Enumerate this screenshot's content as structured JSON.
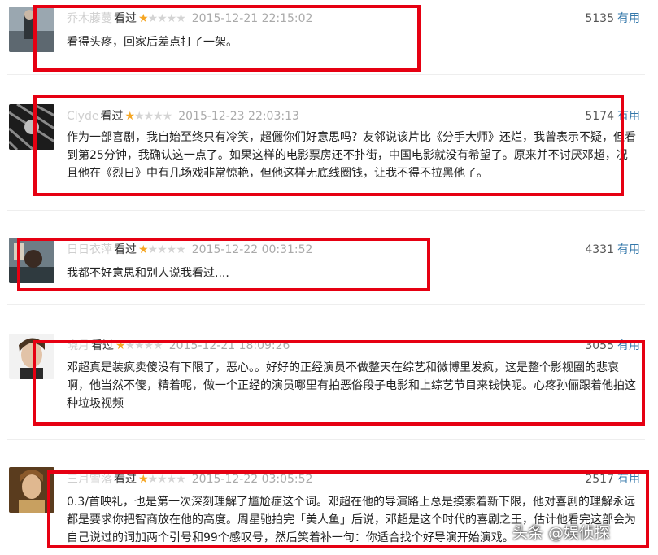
{
  "stars_on_glyph": "★",
  "stars_off_glyph": "★★★★",
  "reviews": [
    {
      "user": "乔木藤蔓",
      "status": "看过",
      "time": "2015-12-21 22:15:02",
      "votes": "5135",
      "useful": "有用",
      "text": "看得头疼，回家后差点打了一架。"
    },
    {
      "user": "Clyde",
      "status": "看过",
      "time": "2015-12-23 22:03:13",
      "votes": "5174",
      "useful": "有用",
      "text": "作为一部喜剧，我自始至终只有冷笑，超儷你们好意思吗？友邻说该片比《分手大师》还烂，我曾表示不疑，但看到第25分钟，我确认这一点了。如果这样的电影票房还不扑街，中国电影就没有希望了。原来并不讨厌邓超，况且他在《烈日》中有几场戏非常惊艳，但他这样无底线圈钱，让我不得不拉黑他了。"
    },
    {
      "user": "日日衣萍",
      "status": "看过",
      "time": "2015-12-22 00:31:52",
      "votes": "4331",
      "useful": "有用",
      "text": "我都不好意思和别人说我看过...."
    },
    {
      "user": "晓月",
      "status": "看过",
      "time": "2015-12-21 18:09:26",
      "votes": "3055",
      "useful": "有用",
      "text": "邓超真是装疯卖傻没有下限了，恶心。。好好的正经演员不做整天在综艺和微博里发疯，这是整个影视圈的悲哀啊，他当然不傻，精着呢，做一个正经的演员哪里有拍恶俗段子电影和上综艺节目来钱快呢。心疼孙俪跟着他拍这种垃圾视频"
    },
    {
      "user": "三月雪落",
      "status": "看过",
      "time": "2015-12-22 03:05:52",
      "votes": "2517",
      "useful": "有用",
      "text": "0.3/首映礼，也是第一次深刻理解了尴尬症这个词。邓超在他的导演路上总是摸索着新下限，他对喜剧的理解永远都是要求你把智商放在他的高度。周星驰拍完「美人鱼」后说，邓超是这个时代的喜剧之王，估计他看完这部会为自己说过的词加两个引号和99个感叹号，然后笑着补一句：你适合找个好导演开始演戏。"
    }
  ],
  "watermark": "头条 @娱侦探"
}
